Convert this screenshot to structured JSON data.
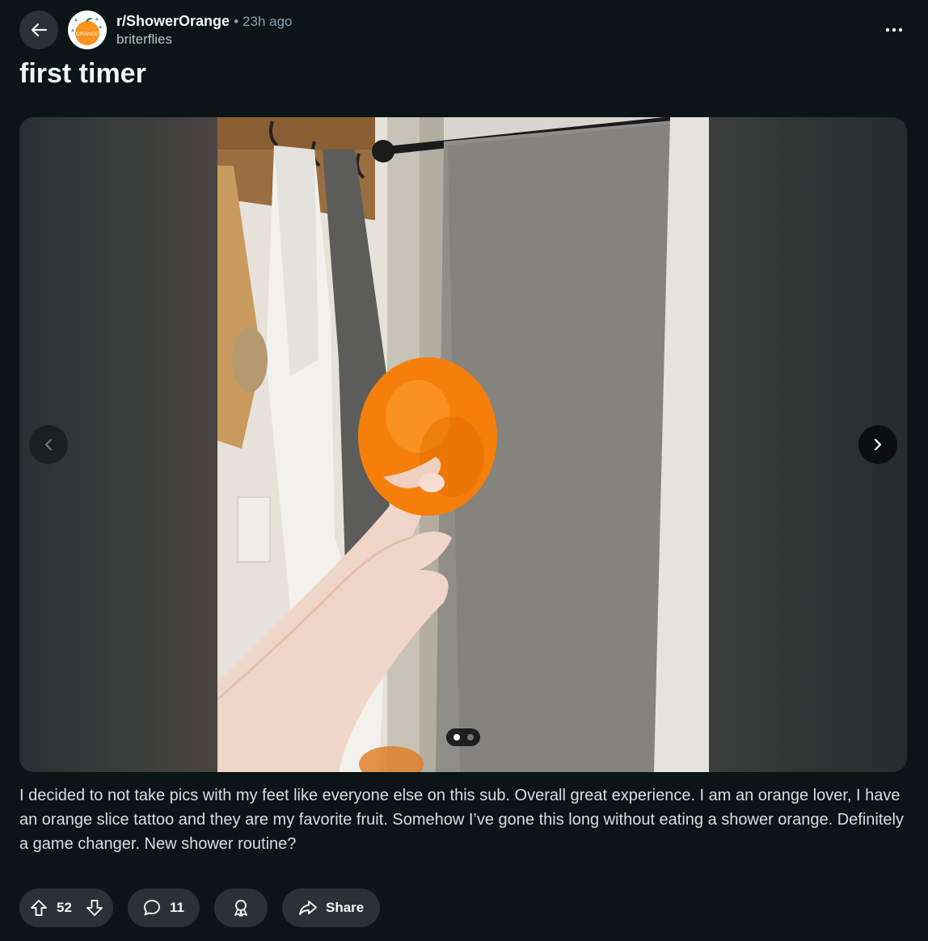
{
  "post": {
    "subreddit": "r/ShowerOrange",
    "separator": "•",
    "time": "23h ago",
    "author": "briterflies",
    "avatar_text": "ORANGE",
    "title": "first timer",
    "body": "I decided to not take pics with my feet like everyone else on this sub. Overall great experience. I am an orange lover, I have an orange slice tattoo and they are my favorite fruit. Somehow I’ve gone this long without eating a shower orange. Definitely a game changer. New shower routine?"
  },
  "gallery": {
    "current_index": 1,
    "total_images": 2
  },
  "actions": {
    "upvotes": "52",
    "comments": "11",
    "share_label": "Share"
  },
  "icons": {
    "back": "arrow-left-icon",
    "more": "ellipsis-icon",
    "prev": "chevron-left-icon",
    "next": "chevron-right-icon",
    "upvote": "arrow-up-icon",
    "downvote": "arrow-down-icon",
    "comment": "speech-bubble-icon",
    "award": "award-ribbon-icon",
    "share": "share-arrow-icon"
  },
  "colors": {
    "background": "#0b1416",
    "pill": "#2a3236",
    "text": "#f2f4f5",
    "muted": "#8ba2ad",
    "orange": "#f7931e"
  }
}
